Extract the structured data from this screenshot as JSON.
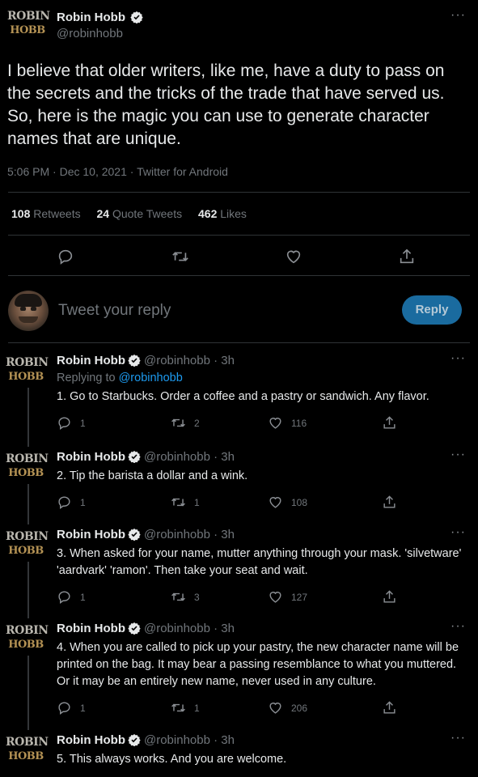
{
  "main_tweet": {
    "avatar_logo": [
      "ROBIN",
      "HOBB"
    ],
    "name": "Robin Hobb",
    "handle": "@robinhobb",
    "more": "···",
    "text": "I believe that older writers, like me, have a duty to pass on the secrets and the tricks of the trade that have served us. So, here is the magic you can use to generate character names that are unique.",
    "time": "5:06 PM",
    "date": "Dec 10, 2021",
    "source": "Twitter for Android",
    "stats": {
      "retweets_count": "108",
      "retweets_label": "Retweets",
      "quotes_count": "24",
      "quotes_label": "Quote Tweets",
      "likes_count": "462",
      "likes_label": "Likes"
    }
  },
  "composer": {
    "placeholder": "Tweet your reply",
    "reply_button": "Reply"
  },
  "replies": [
    {
      "name": "Robin Hobb",
      "handle": "@robinhobb",
      "time": "3h",
      "replying_to_label": "Replying to",
      "replying_to": "@robinhobb",
      "text": "1. Go to Starbucks. Order a coffee and a pastry or sandwich. Any flavor.",
      "replies": "1",
      "retweets": "2",
      "likes": "116"
    },
    {
      "name": "Robin Hobb",
      "handle": "@robinhobb",
      "time": "3h",
      "text": "2. Tip the barista a dollar and a wink.",
      "replies": "1",
      "retweets": "1",
      "likes": "108"
    },
    {
      "name": "Robin Hobb",
      "handle": "@robinhobb",
      "time": "3h",
      "text": "3. When asked for your name, mutter anything through your mask. 'silvetware' 'aardvark' 'ramon'. Then take your seat and wait.",
      "replies": "1",
      "retweets": "3",
      "likes": "127"
    },
    {
      "name": "Robin Hobb",
      "handle": "@robinhobb",
      "time": "3h",
      "text": "4. When you are called to pick up your pastry, the new character name will be printed on the bag. It may bear a passing resemblance to what you muttered. Or it may be an entirely new name, never used in any culture.",
      "replies": "1",
      "retweets": "1",
      "likes": "206"
    },
    {
      "name": "Robin Hobb",
      "handle": "@robinhobb",
      "time": "3h",
      "text": "5. This always works. And you are welcome."
    }
  ],
  "colors": {
    "accent": "#1d9bf0",
    "background": "#000000",
    "muted": "#71767b",
    "divider": "#2f3336"
  },
  "icons": [
    "verified-badge-icon",
    "reply-icon",
    "retweet-icon",
    "like-icon",
    "share-icon",
    "more-icon"
  ]
}
